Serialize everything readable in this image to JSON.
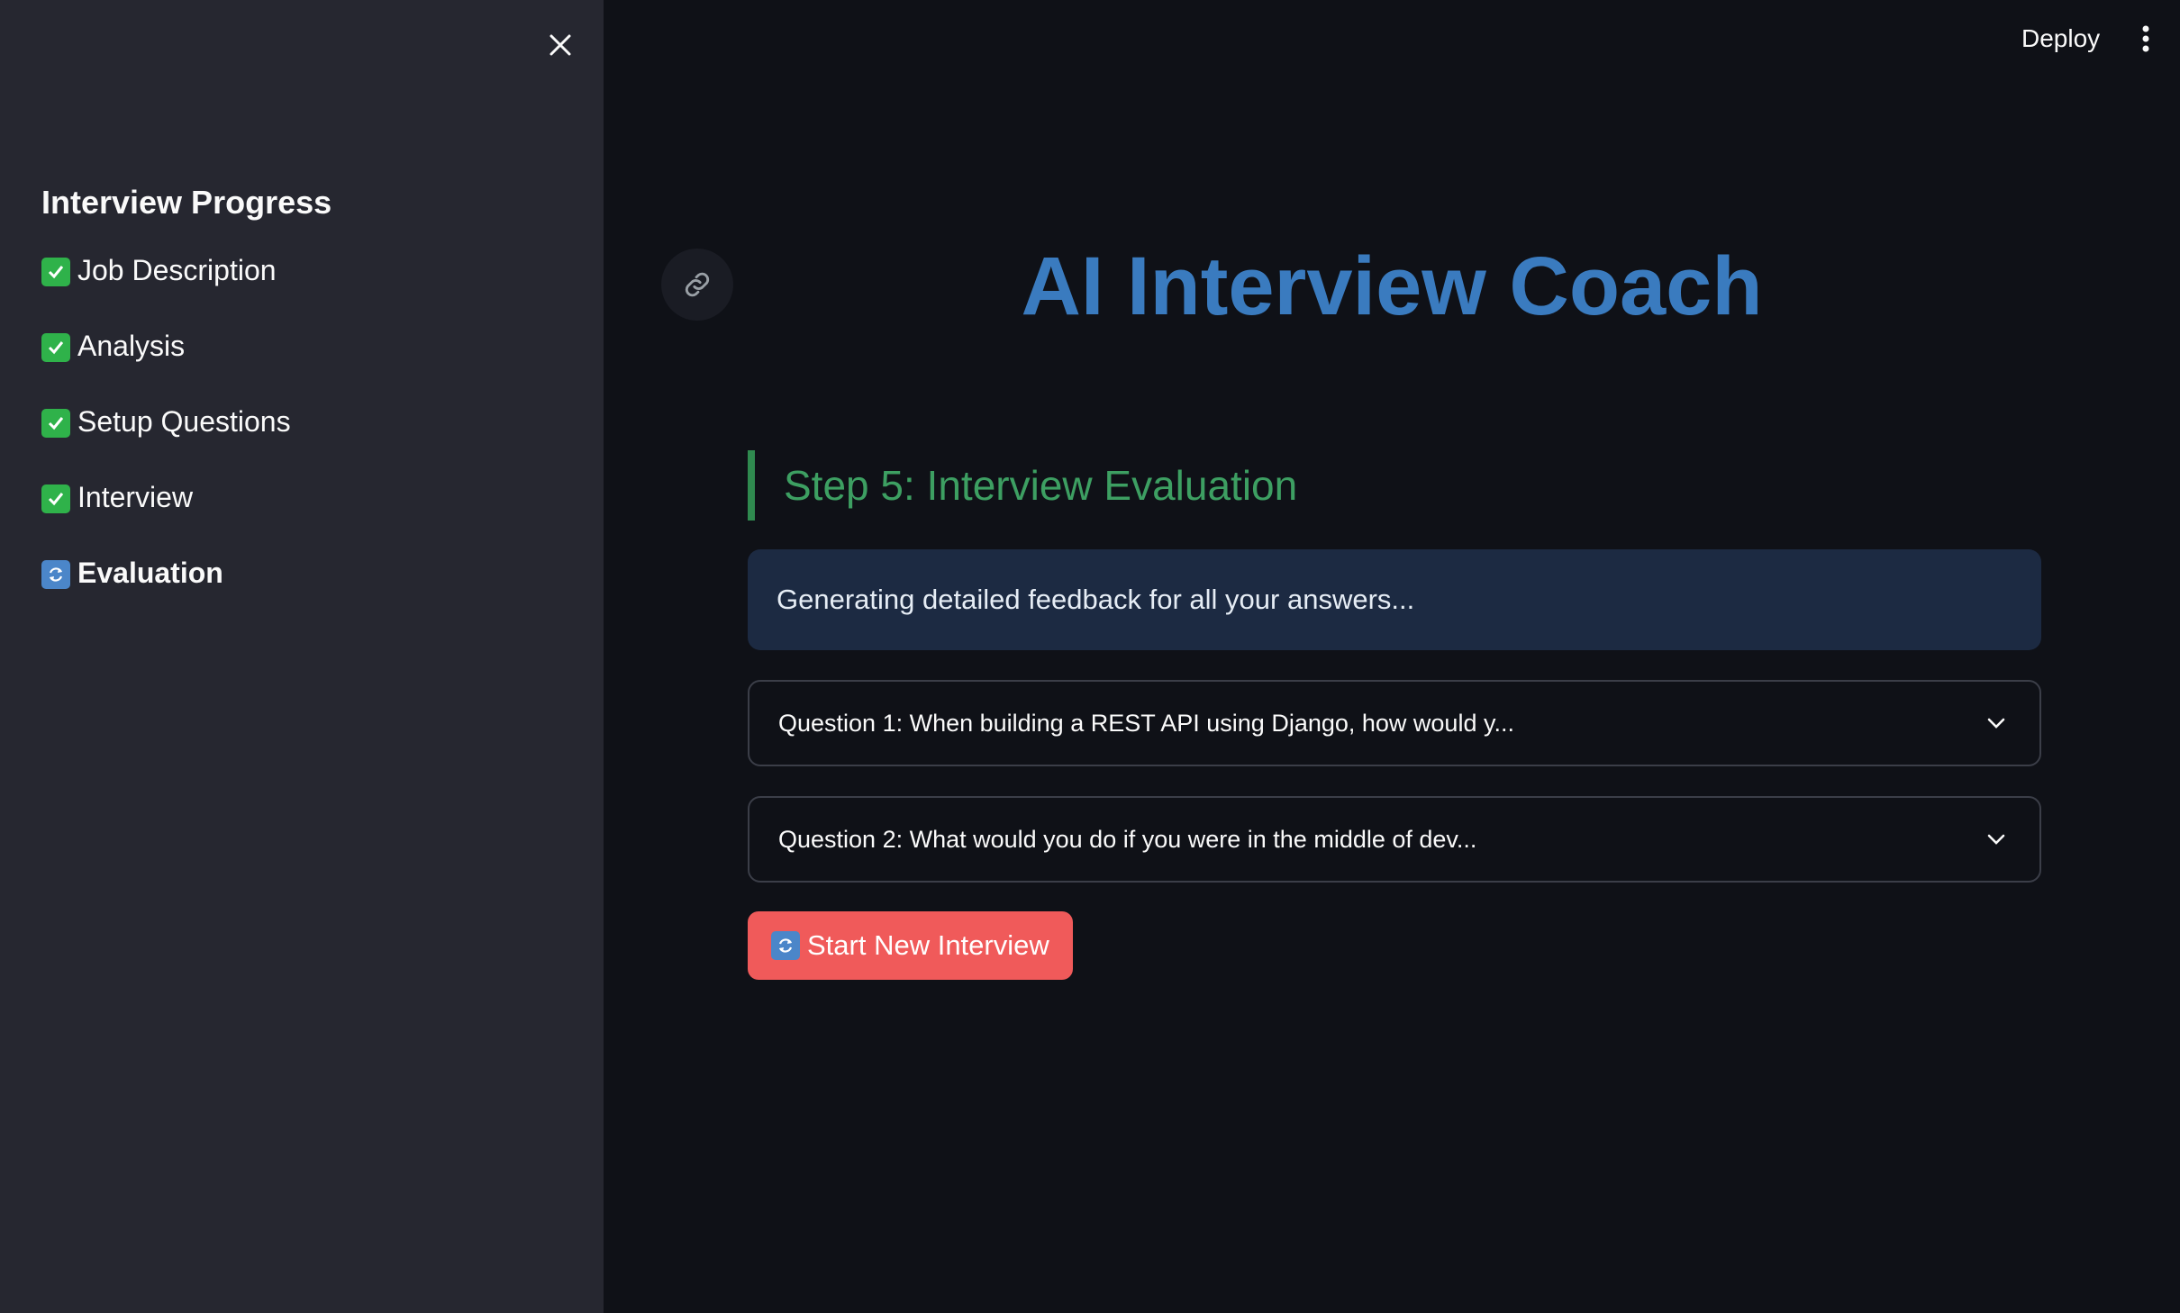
{
  "header": {
    "deploy_label": "Deploy",
    "menu_icon": "vertical-dots-icon"
  },
  "sidebar": {
    "close_icon": "close-icon",
    "title": "Interview Progress",
    "items": [
      {
        "label": "Job Description",
        "status": "complete",
        "icon": "check-icon"
      },
      {
        "label": "Analysis",
        "status": "complete",
        "icon": "check-icon"
      },
      {
        "label": "Setup Questions",
        "status": "complete",
        "icon": "check-icon"
      },
      {
        "label": "Interview",
        "status": "complete",
        "icon": "check-icon"
      },
      {
        "label": "Evaluation",
        "status": "in-progress",
        "icon": "refresh-icon"
      }
    ]
  },
  "main": {
    "title": "AI Interview Coach",
    "anchor_icon": "link-icon",
    "step_heading": "Step 5: Interview Evaluation",
    "info_message": "Generating detailed feedback for all your answers...",
    "questions": [
      {
        "label": "Question 1: When building a REST API using Django, how would y..."
      },
      {
        "label": "Question 2: What would you do if you were in the middle of dev..."
      }
    ],
    "restart_button_label": "Start New Interview"
  },
  "colors": {
    "background": "#0f1117",
    "sidebar": "#262730",
    "title": "#3a7bbf",
    "step_heading": "#3d9f62",
    "info_box": "#1c2a42",
    "primary_button": "#f05a5a"
  }
}
